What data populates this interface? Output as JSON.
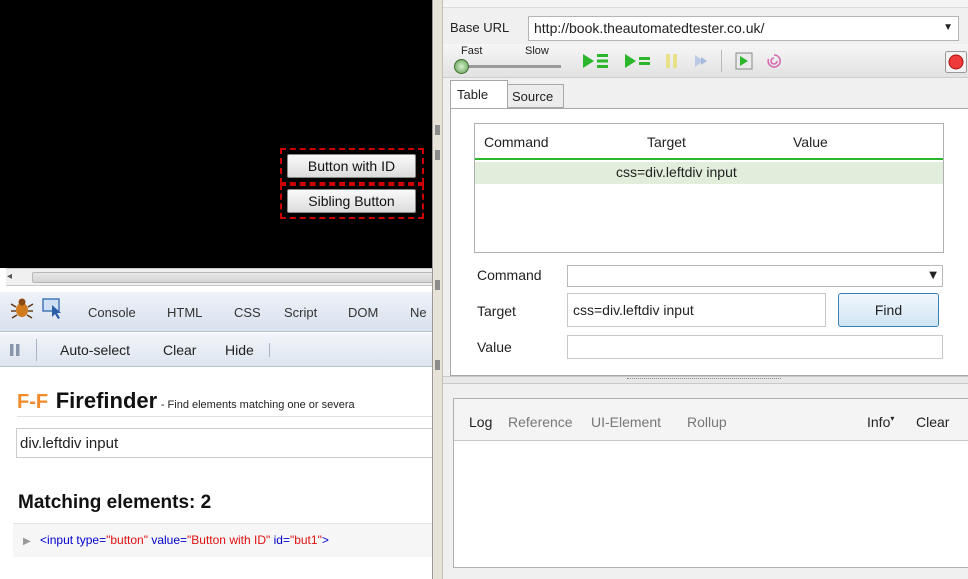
{
  "page": {
    "button_with_id": "Button with ID",
    "sibling_button": "Sibling Button"
  },
  "firebug": {
    "tabs": [
      "Console",
      "HTML",
      "CSS",
      "Script",
      "DOM",
      "Ne"
    ],
    "subbar": {
      "autoselect": "Auto-select",
      "clear": "Clear",
      "hide": "Hide"
    }
  },
  "firefinder": {
    "logo": "F-F",
    "title": "Firefinder",
    "subtitle": "- Find elements matching one or severa",
    "input_value": "div.leftdiv input",
    "matching": "Matching elements: 2",
    "result": {
      "prefix": "<input type=",
      "type_val": "\"button\"",
      "value_attr": " value=",
      "value_val": "\"Button with ID\"",
      "id_attr": " id=",
      "id_val": "\"but1\"",
      "suffix": ">"
    }
  },
  "ide": {
    "base_url_label": "Base URL",
    "base_url_value": "http://book.theautomatedtester.co.uk/",
    "fast_label": "Fast",
    "slow_label": "Slow",
    "tabs": {
      "table": "Table",
      "source": "Source"
    },
    "table": {
      "headers": {
        "command": "Command",
        "target": "Target",
        "value": "Value"
      },
      "rows": [
        {
          "command": "",
          "target": "css=div.leftdiv input",
          "value": ""
        }
      ]
    },
    "form": {
      "command_label": "Command",
      "command_value": "",
      "target_label": "Target",
      "target_value": "css=div.leftdiv input",
      "find_button": "Find",
      "value_label": "Value",
      "value_value": ""
    },
    "bottom_tabs": {
      "log": "Log",
      "reference": "Reference",
      "ui_element": "UI-Element",
      "rollup": "Rollup",
      "info": "Info",
      "clear": "Clear"
    }
  },
  "colors": {
    "accent_green": "#2bb62b",
    "attr_red": "#e01010",
    "tag_blue": "#0000cc",
    "dash_red": "#cc0000"
  }
}
